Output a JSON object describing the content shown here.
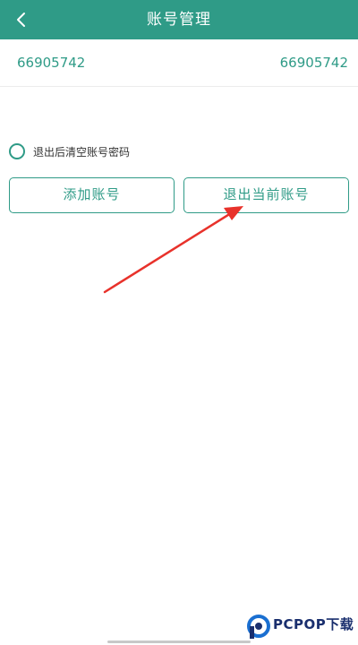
{
  "header": {
    "title": "账号管理",
    "back_icon": "chevron-left-icon",
    "color": "#2f9b87"
  },
  "account": {
    "left_text": "66905742",
    "right_text": "66905742"
  },
  "options": {
    "clear_label": "退出后清空账号密码",
    "checked": false
  },
  "buttons": {
    "add_label": "添加账号",
    "logout_label": "退出当前账号"
  },
  "annotation": {
    "arrow_color": "#e8322b"
  },
  "watermark": {
    "text": "PCPOP下载"
  }
}
